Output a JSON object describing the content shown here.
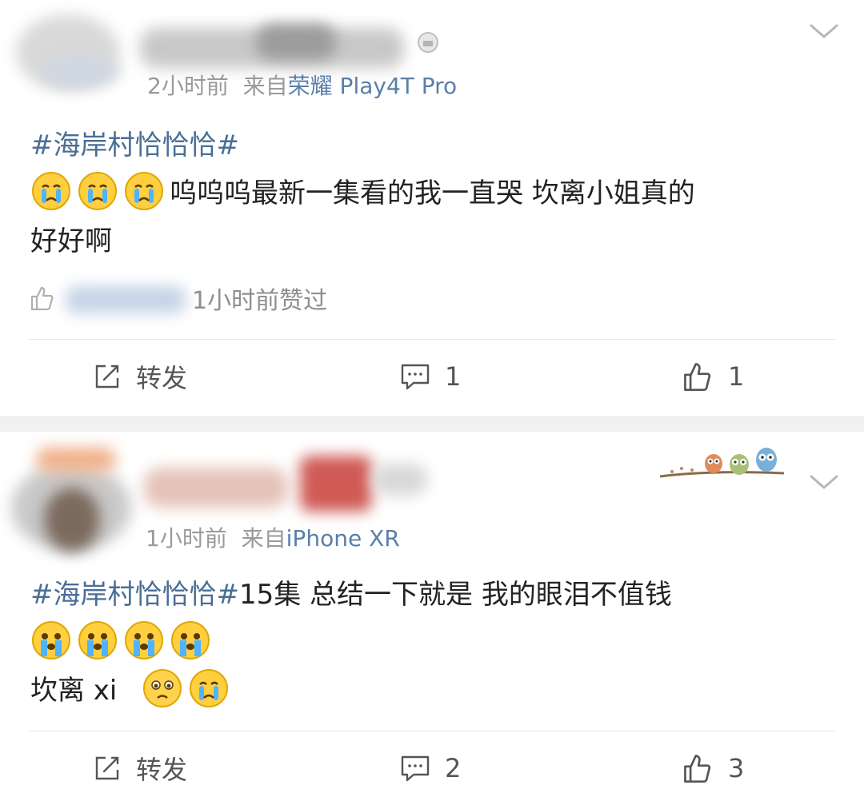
{
  "posts": [
    {
      "meta": {
        "time": "2小时前",
        "from": "来自",
        "source": "荣耀 Play4T Pro"
      },
      "content": {
        "hashtag": "#海岸村恰恰恰#",
        "text_line1": "呜呜呜最新一集看的我一直哭  坎离小姐真的",
        "text_line2": "好好啊"
      },
      "liked_by": {
        "text": "1小时前赞过"
      },
      "actions": {
        "repost_label": "转发",
        "comment_count": "1",
        "like_count": "1"
      }
    },
    {
      "meta": {
        "time": "1小时前",
        "from": "来自",
        "source": "iPhone XR"
      },
      "content": {
        "hashtag": "#海岸村恰恰恰#",
        "text_line1": "15集 总结一下就是  我的眼泪不值钱",
        "text_line3": "坎离 xi"
      },
      "actions": {
        "repost_label": "转发",
        "comment_count": "2",
        "like_count": "3"
      }
    }
  ],
  "colors": {
    "hashtag": "#4a6e95",
    "source": "#5a7fa8",
    "meta": "#9a9a9a",
    "separator": "#f1f1f1"
  },
  "icons": [
    "chevron-down-icon",
    "thumbs-up-icon",
    "repost-icon",
    "comment-icon",
    "crying-emoji",
    "pleading-emoji",
    "owl-branch-decoration"
  ]
}
